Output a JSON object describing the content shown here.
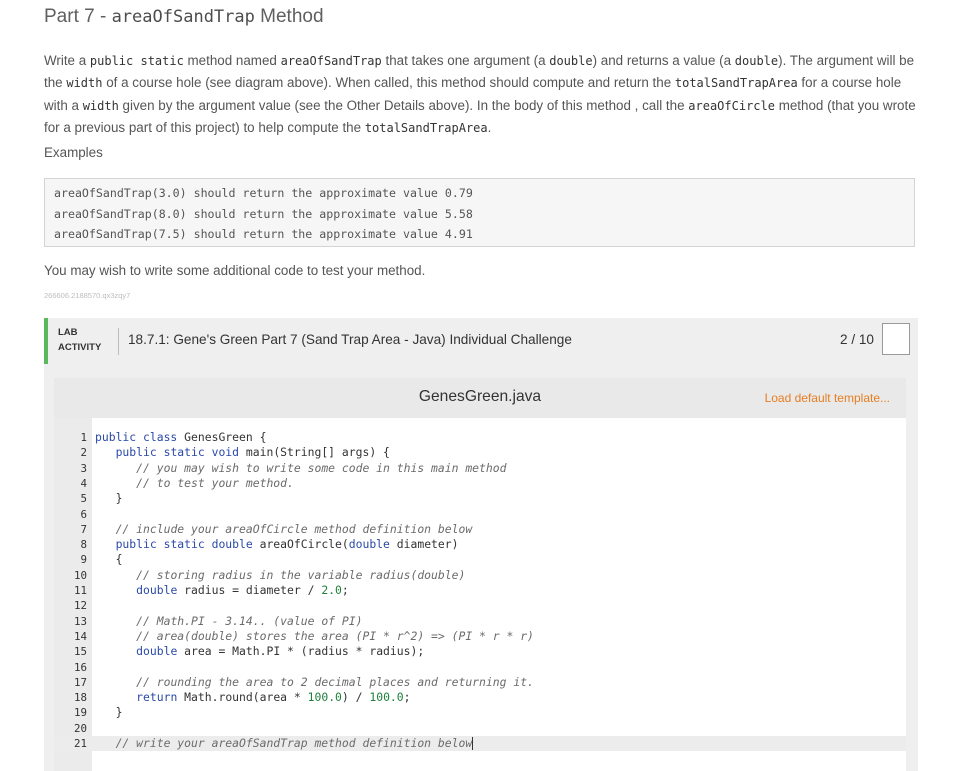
{
  "title": {
    "prefix": "Part 7 - ",
    "code": "areaOfSandTrap",
    "suffix": " Method"
  },
  "description": [
    {
      "t": "Write a "
    },
    {
      "c": "public static"
    },
    {
      "t": " method named "
    },
    {
      "c": "areaOfSandTrap"
    },
    {
      "t": " that takes one argument (a "
    },
    {
      "c": "double"
    },
    {
      "t": ") and returns a value (a "
    },
    {
      "c": "double"
    },
    {
      "t": "). The argument will be the "
    },
    {
      "c": "width"
    },
    {
      "t": " of a course hole (see diagram above). When called, this method should compute and return the "
    },
    {
      "c": "totalSandTrapArea"
    },
    {
      "t": " for a course hole with a "
    },
    {
      "c": "width"
    },
    {
      "t": " given by the argument value (see the "
    },
    {
      "b": "Other Details"
    },
    {
      "t": " above). In the body of this method , call the "
    },
    {
      "c": "areaOfCircle"
    },
    {
      "t": " method (that you wrote for a previous part of this project) to help compute the "
    },
    {
      "c": "totalSandTrapArea"
    },
    {
      "t": "."
    }
  ],
  "examples_label": "Examples",
  "examples": [
    "areaOfSandTrap(3.0) should return the approximate value 0.79",
    "areaOfSandTrap(8.0) should return the approximate value 5.58",
    "areaOfSandTrap(7.5) should return the approximate value 4.91"
  ],
  "testing_note": "You may wish to write some additional code to test your method.",
  "tiny_id": "266606.2188570.qx3zqy7",
  "lab": {
    "tag_line1": "LAB",
    "tag_line2": "ACTIVITY",
    "title": "18.7.1: Gene's Green Part 7 (Sand Trap Area - Java) Individual Challenge",
    "score": "2 / 10"
  },
  "editor": {
    "file_name": "GenesGreen.java",
    "load_default": "Load default template...",
    "active_line": 21,
    "lines": [
      [
        [
          "kw",
          "public class "
        ],
        [
          "p",
          "GenesGreen {"
        ]
      ],
      [
        [
          "p",
          "   "
        ],
        [
          "kw",
          "public static void "
        ],
        [
          "p",
          "main(String[] args) {"
        ]
      ],
      [
        [
          "p",
          "      "
        ],
        [
          "cm",
          "// you may wish to write some code in this main method"
        ]
      ],
      [
        [
          "p",
          "      "
        ],
        [
          "cm",
          "// to test your method."
        ]
      ],
      [
        [
          "p",
          "   }"
        ]
      ],
      [],
      [
        [
          "p",
          "   "
        ],
        [
          "cm",
          "// include your areaOfCircle method definition below"
        ]
      ],
      [
        [
          "p",
          "   "
        ],
        [
          "kw",
          "public static double "
        ],
        [
          "p",
          "areaOfCircle("
        ],
        [
          "kw",
          "double "
        ],
        [
          "p",
          "diameter)"
        ]
      ],
      [
        [
          "p",
          "   {"
        ]
      ],
      [
        [
          "p",
          "      "
        ],
        [
          "cm",
          "// storing radius in the variable radius(double)"
        ]
      ],
      [
        [
          "p",
          "      "
        ],
        [
          "kw",
          "double "
        ],
        [
          "p",
          "radius = diameter / "
        ],
        [
          "num",
          "2.0"
        ],
        [
          "p",
          ";"
        ]
      ],
      [],
      [
        [
          "p",
          "      "
        ],
        [
          "cm",
          "// Math.PI - 3.14.. (value of PI)"
        ]
      ],
      [
        [
          "p",
          "      "
        ],
        [
          "cm",
          "// area(double) stores the area (PI * r^2) => (PI * r * r)"
        ]
      ],
      [
        [
          "p",
          "      "
        ],
        [
          "kw",
          "double "
        ],
        [
          "p",
          "area = Math.PI * (radius * radius);"
        ]
      ],
      [],
      [
        [
          "p",
          "      "
        ],
        [
          "cm",
          "// rounding the area to 2 decimal places and returning it."
        ]
      ],
      [
        [
          "p",
          "      "
        ],
        [
          "kw",
          "return "
        ],
        [
          "p",
          "Math.round(area * "
        ],
        [
          "num",
          "100.0"
        ],
        [
          "p",
          ") / "
        ],
        [
          "num",
          "100.0"
        ],
        [
          "p",
          ";"
        ]
      ],
      [
        [
          "p",
          "   }"
        ]
      ],
      [],
      [
        [
          "p",
          "   "
        ],
        [
          "cm",
          "// write your areaOfSandTrap method definition below"
        ]
      ]
    ]
  }
}
